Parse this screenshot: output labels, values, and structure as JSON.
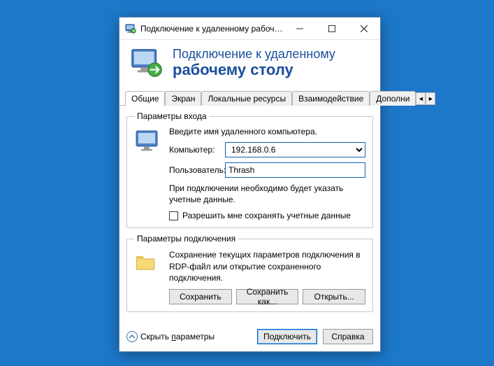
{
  "titlebar": {
    "text": "Подключение к удаленному рабочему с..."
  },
  "header": {
    "line1": "Подключение к удаленному",
    "line2": "рабочему столу"
  },
  "tabs": {
    "t0": "Общие",
    "t1": "Экран",
    "t2": "Локальные ресурсы",
    "t3": "Взаимодействие",
    "t4": "Дополни"
  },
  "logon": {
    "legend": "Параметры входа",
    "instruction": "Введите имя удаленного компьютера.",
    "computer_label": "Компьютер:",
    "computer_value": "192.168.0.6",
    "user_label": "Пользователь:",
    "user_value": "Thrash",
    "note": "При подключении необходимо будет указать учетные данные.",
    "save_creds": "Разрешить мне сохранять учетные данные"
  },
  "conn": {
    "legend": "Параметры подключения",
    "desc": "Сохранение текущих параметров подключения в RDP-файл или открытие сохраненного подключения.",
    "save": "Сохранить",
    "save_as": "Сохранить как...",
    "open": "Открыть..."
  },
  "footer": {
    "hide": "Скрыть ",
    "hide_u": "п",
    "hide_rest": "араметры",
    "connect": "Подключить",
    "help": "Справка"
  }
}
